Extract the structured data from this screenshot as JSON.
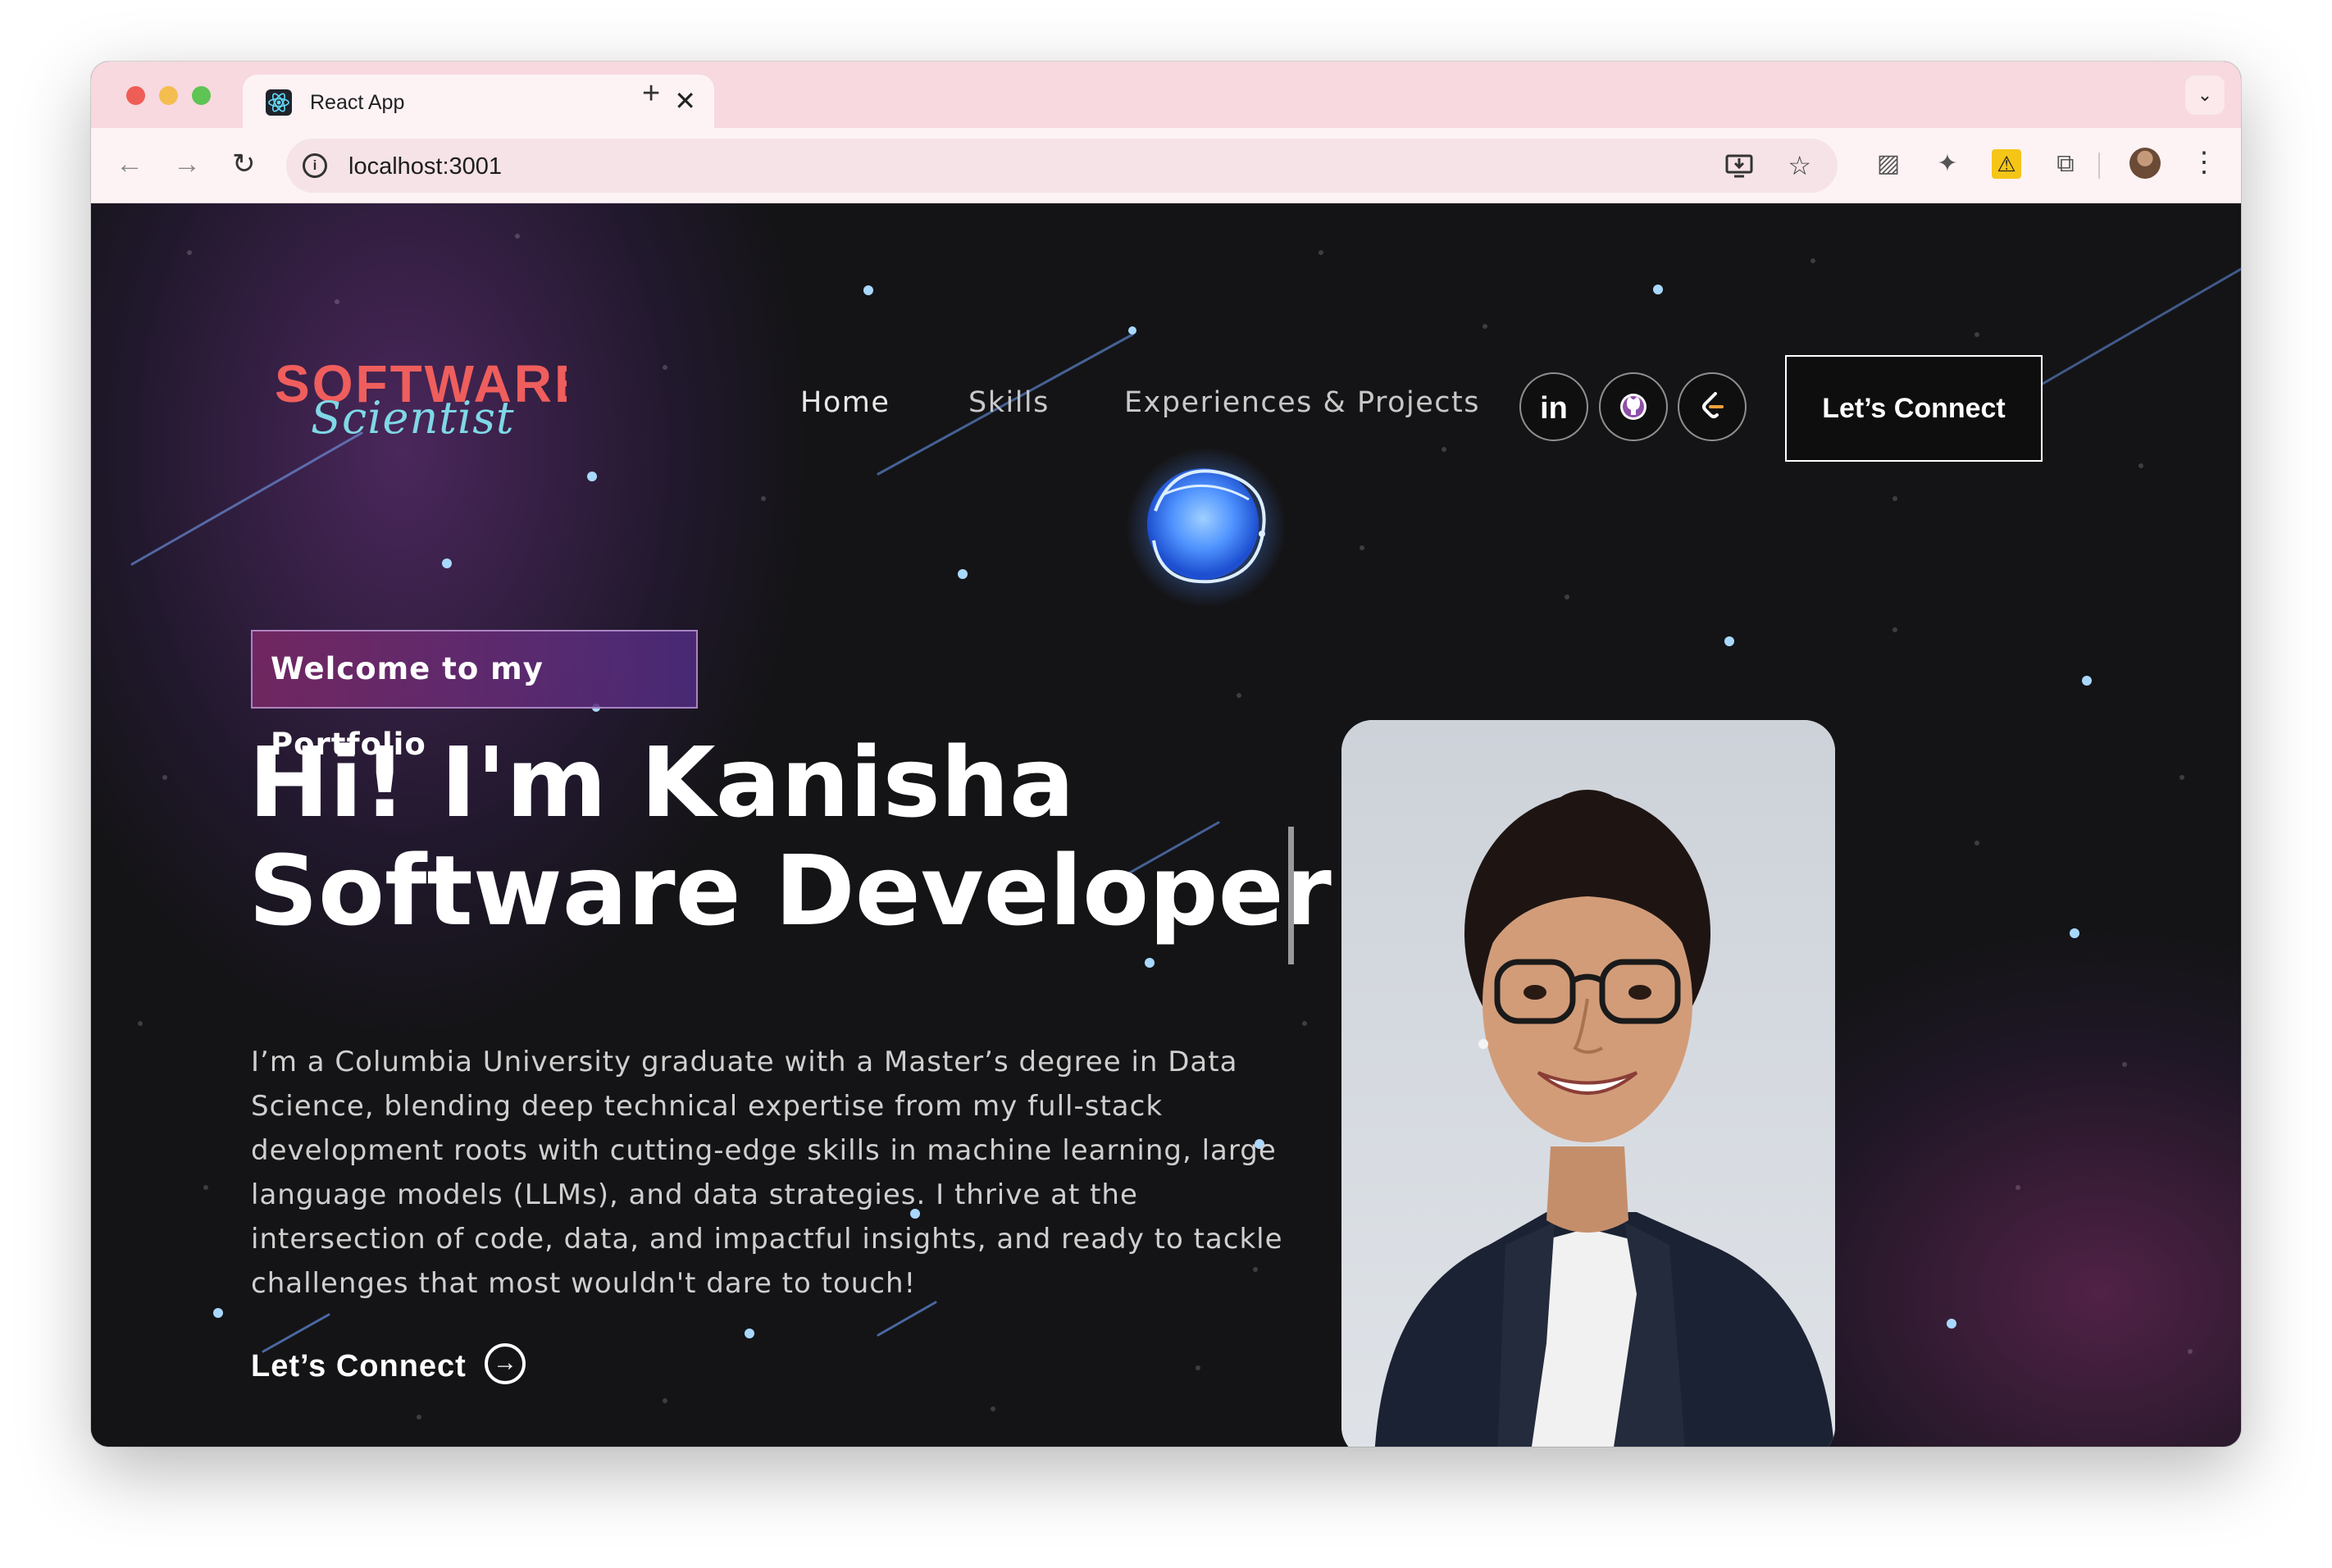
{
  "browser": {
    "tab_title": "React App",
    "url": "localhost:3001",
    "new_tab_symbol": "+",
    "close_symbol": "✕"
  },
  "site": {
    "logo_line1": "SOFTWARE",
    "logo_line2": "Scientist",
    "nav": {
      "home": "Home",
      "skills": "Skills",
      "experiences": "Experiences & Projects"
    },
    "social": {
      "linkedin": "in"
    },
    "connect_button": "Let’s Connect",
    "badge": "Welcome to my Portfolio",
    "headline_line1": "Hi! I'm Kanisha",
    "headline_line2": "Software Developer",
    "bio": "I’m a Columbia University graduate with a Master’s degree in Data Science, blending deep technical expertise from my full-stack development roots with cutting-edge skills in machine learning, large language models (LLMs), and data strategies. I thrive at the intersection of code, data, and impactful insights, and ready to tackle challenges that most wouldn't dare to touch!",
    "bottom_connect": "Let’s Connect"
  },
  "icons": {
    "tab_favicon": "react-icon",
    "info": "info-icon",
    "install": "install-icon",
    "bookmark": "star-icon",
    "extensions": [
      "bookmark-extension-icon",
      "puzzle-extension-icon",
      "warning-extension-icon",
      "extensions-icon"
    ],
    "profile": "profile-avatar",
    "menu": "kebab-menu-icon",
    "social": [
      "linkedin-icon",
      "github-icon",
      "leetcode-icon"
    ],
    "arrow": "arrow-right-circle-icon"
  },
  "colors": {
    "tabbar": "#f7d9df",
    "page_bg": "#141416",
    "logo_red": "#ef5e5c",
    "logo_cyan": "#7fd8e6",
    "badge_gradient_start": "#782864",
    "badge_gradient_end": "#502d82"
  }
}
